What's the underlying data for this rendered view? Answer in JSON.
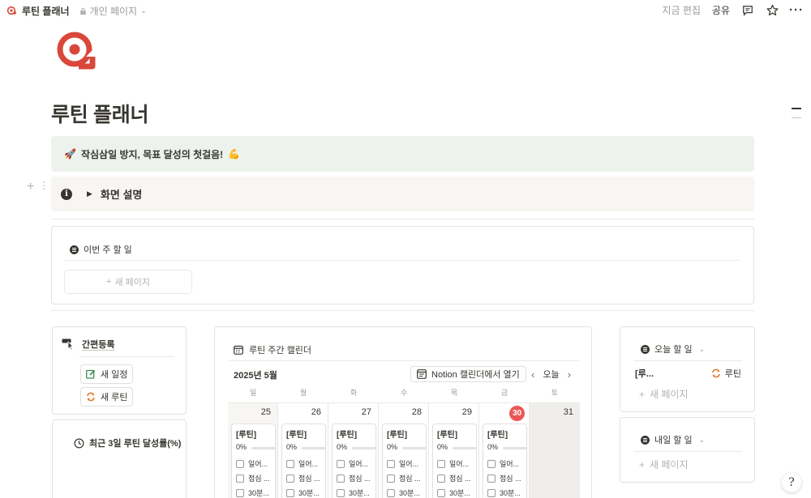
{
  "topbar": {
    "title": "루틴 플래너",
    "private_label": "개인 페이지",
    "edited": "지금 편집",
    "share": "공유"
  },
  "page": {
    "title": "루틴 플래너"
  },
  "callout_green": {
    "emoji_left": "🚀",
    "text": "작심삼일 방지, 목표 달성의 첫걸음!",
    "emoji_right": "💪"
  },
  "callout_gray": {
    "label": "화면 설명"
  },
  "weekly": {
    "heading": "이번 주 할 일",
    "new_page": "새 페이지"
  },
  "quick": {
    "heading": "간편등록",
    "new_schedule": "새 일정",
    "new_routine": "새 루틴"
  },
  "rate": {
    "heading": "최근 3일 루틴 달성률(%)"
  },
  "calendar": {
    "heading": "루틴 주간 캘린더",
    "month": "2025년 5월",
    "open_notion": "Notion 캘린더에서 열기",
    "today": "오늘",
    "weekdays": [
      "일",
      "월",
      "화",
      "수",
      "목",
      "금",
      "토"
    ],
    "days": [
      {
        "num": "25",
        "routine": {
          "title": "[루틴]",
          "pct": "0%",
          "progress": 0,
          "items": [
            "일어...",
            "점심 ...",
            "30분..."
          ]
        }
      },
      {
        "num": "26",
        "routine": {
          "title": "[루틴]",
          "pct": "0%",
          "progress": 0,
          "items": [
            "일어...",
            "점심 ...",
            "30분..."
          ]
        }
      },
      {
        "num": "27",
        "routine": {
          "title": "[루틴]",
          "pct": "0%",
          "progress": 0,
          "items": [
            "일어...",
            "점심 ...",
            "30분..."
          ]
        }
      },
      {
        "num": "28",
        "routine": {
          "title": "[루틴]",
          "pct": "0%",
          "progress": 0,
          "items": [
            "일어...",
            "점심 ...",
            "30분..."
          ]
        }
      },
      {
        "num": "29",
        "routine": {
          "title": "[루틴]",
          "pct": "0%",
          "progress": 0,
          "items": [
            "일어...",
            "점심 ...",
            "30분..."
          ]
        }
      },
      {
        "num": "30",
        "today": true,
        "routine": {
          "title": "[루틴]",
          "pct": "0%",
          "progress": 0,
          "items": [
            "일어...",
            "점심 ...",
            "30분..."
          ]
        }
      },
      {
        "num": "31"
      }
    ],
    "today_color": "#eb5757"
  },
  "today_todo": {
    "heading": "오늘 할 일",
    "item": "[루...",
    "tag": "루틴",
    "new_page": "새 페이지"
  },
  "tomorrow_todo": {
    "heading": "내일 할 일",
    "new_page": "새 페이지"
  },
  "colors": {
    "brand": "#d9473b",
    "callout_green_bg": "#edf3ec",
    "callout_gray_bg": "#f7f6f3"
  },
  "icons": [
    "routine-logo-icon",
    "lock-icon",
    "chevron-down-icon",
    "comment-icon",
    "star-icon",
    "more-icon",
    "info-icon",
    "filter-icon",
    "pointer-icon",
    "edit-icon",
    "refresh-icon",
    "clock-icon",
    "calendar-icon",
    "help-icon"
  ]
}
